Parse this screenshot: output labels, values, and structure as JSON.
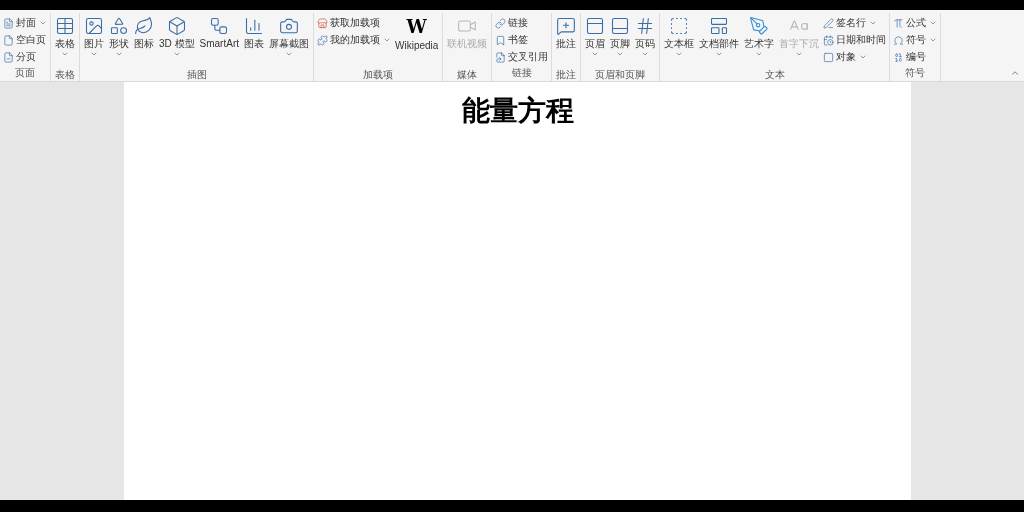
{
  "ribbon": {
    "groups": [
      {
        "label": "页面",
        "items": [
          {
            "kind": "small",
            "label": "封面",
            "dropdown": true,
            "disabled": false
          },
          {
            "kind": "small",
            "label": "空白页",
            "dropdown": false,
            "disabled": false
          },
          {
            "kind": "small",
            "label": "分页",
            "dropdown": false,
            "disabled": false
          }
        ]
      },
      {
        "label": "表格",
        "items": [
          {
            "kind": "large",
            "label": "表格",
            "dropdown": true,
            "disabled": false
          }
        ]
      },
      {
        "label": "插图",
        "items": [
          {
            "kind": "large",
            "label": "图片",
            "dropdown": true,
            "disabled": false
          },
          {
            "kind": "large",
            "label": "形状",
            "dropdown": true,
            "disabled": false
          },
          {
            "kind": "large",
            "label": "图标",
            "dropdown": false,
            "disabled": false
          },
          {
            "kind": "large",
            "label": "3D 模型",
            "dropdown": true,
            "disabled": false
          },
          {
            "kind": "large",
            "label": "SmartArt",
            "dropdown": false,
            "disabled": false
          },
          {
            "kind": "large",
            "label": "图表",
            "dropdown": false,
            "disabled": false
          },
          {
            "kind": "large",
            "label": "屏幕截图",
            "dropdown": true,
            "disabled": false
          }
        ]
      },
      {
        "label": "加载项",
        "items": [
          {
            "kind": "small",
            "label": "获取加载项",
            "dropdown": false,
            "disabled": false
          },
          {
            "kind": "small",
            "label": "我的加载项",
            "dropdown": true,
            "disabled": false
          },
          {
            "kind": "logo",
            "logo": "W",
            "label": "Wikipedia",
            "dropdown": false,
            "disabled": false
          }
        ]
      },
      {
        "label": "媒体",
        "items": [
          {
            "kind": "large",
            "label": "联机视频",
            "dropdown": false,
            "disabled": true
          }
        ]
      },
      {
        "label": "链接",
        "items": [
          {
            "kind": "small",
            "label": "链接",
            "dropdown": false,
            "disabled": false
          },
          {
            "kind": "small",
            "label": "书签",
            "dropdown": false,
            "disabled": false
          },
          {
            "kind": "small",
            "label": "交叉引用",
            "dropdown": false,
            "disabled": false
          }
        ]
      },
      {
        "label": "批注",
        "items": [
          {
            "kind": "large",
            "label": "批注",
            "dropdown": false,
            "disabled": false
          }
        ]
      },
      {
        "label": "页眉和页脚",
        "items": [
          {
            "kind": "large",
            "label": "页眉",
            "dropdown": true,
            "disabled": false
          },
          {
            "kind": "large",
            "label": "页脚",
            "dropdown": true,
            "disabled": false
          },
          {
            "kind": "large",
            "label": "页码",
            "dropdown": true,
            "disabled": false
          }
        ]
      },
      {
        "label": "文本",
        "items": [
          {
            "kind": "large",
            "label": "文本框",
            "dropdown": true,
            "disabled": false
          },
          {
            "kind": "large",
            "label": "文档部件",
            "dropdown": true,
            "disabled": false
          },
          {
            "kind": "large",
            "label": "艺术字",
            "dropdown": true,
            "disabled": false
          },
          {
            "kind": "large",
            "label": "首字下沉",
            "dropdown": true,
            "disabled": true
          },
          {
            "kind": "small",
            "label": "签名行",
            "dropdown": true,
            "disabled": false
          },
          {
            "kind": "small",
            "label": "日期和时间",
            "dropdown": false,
            "disabled": false
          },
          {
            "kind": "small",
            "label": "对象",
            "dropdown": true,
            "disabled": false
          }
        ]
      },
      {
        "label": "符号",
        "items": [
          {
            "kind": "small",
            "label": "公式",
            "dropdown": true,
            "disabled": false
          },
          {
            "kind": "small",
            "label": "符号",
            "dropdown": true,
            "disabled": false
          },
          {
            "kind": "small",
            "label": "编号",
            "dropdown": false,
            "disabled": false
          }
        ]
      }
    ]
  },
  "document": {
    "title": "能量方程"
  }
}
